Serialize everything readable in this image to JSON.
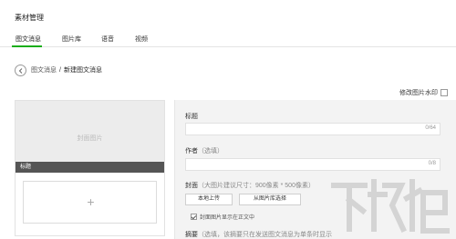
{
  "app": {
    "title": "素材管理"
  },
  "tabs": [
    {
      "label": "图文消息",
      "active": true
    },
    {
      "label": "图片库",
      "active": false
    },
    {
      "label": "语音",
      "active": false
    },
    {
      "label": "视频",
      "active": false
    }
  ],
  "breadcrumb": {
    "parent": "图文消息",
    "separator": "/",
    "current": "新建图文消息"
  },
  "watermark_option": {
    "label": "修改图片水印"
  },
  "preview": {
    "cover_placeholder": "封面图片",
    "title_bar": "标题",
    "add_symbol": "+"
  },
  "editor": {
    "title_label": "标题",
    "title_counter": "0/64",
    "author_label": "作者",
    "author_hint": "（选填）",
    "author_counter": "0/8",
    "cover_label": "封面",
    "cover_hint": "（大图片建议尺寸：900像素 * 500像素）",
    "upload_local": "本地上传",
    "choose_from_library": "从图片库选择",
    "show_cover_in_body": "封面图片显示在正文中",
    "summary_label": "摘要",
    "summary_hint": "（选填，该摘要只在发送图文消息为单条时显示"
  },
  "colors": {
    "accent": "#1aad19",
    "title_bar": "#555555",
    "editor_bg": "#f3f3f3"
  },
  "icons": {
    "back": "chevron-left-icon"
  }
}
